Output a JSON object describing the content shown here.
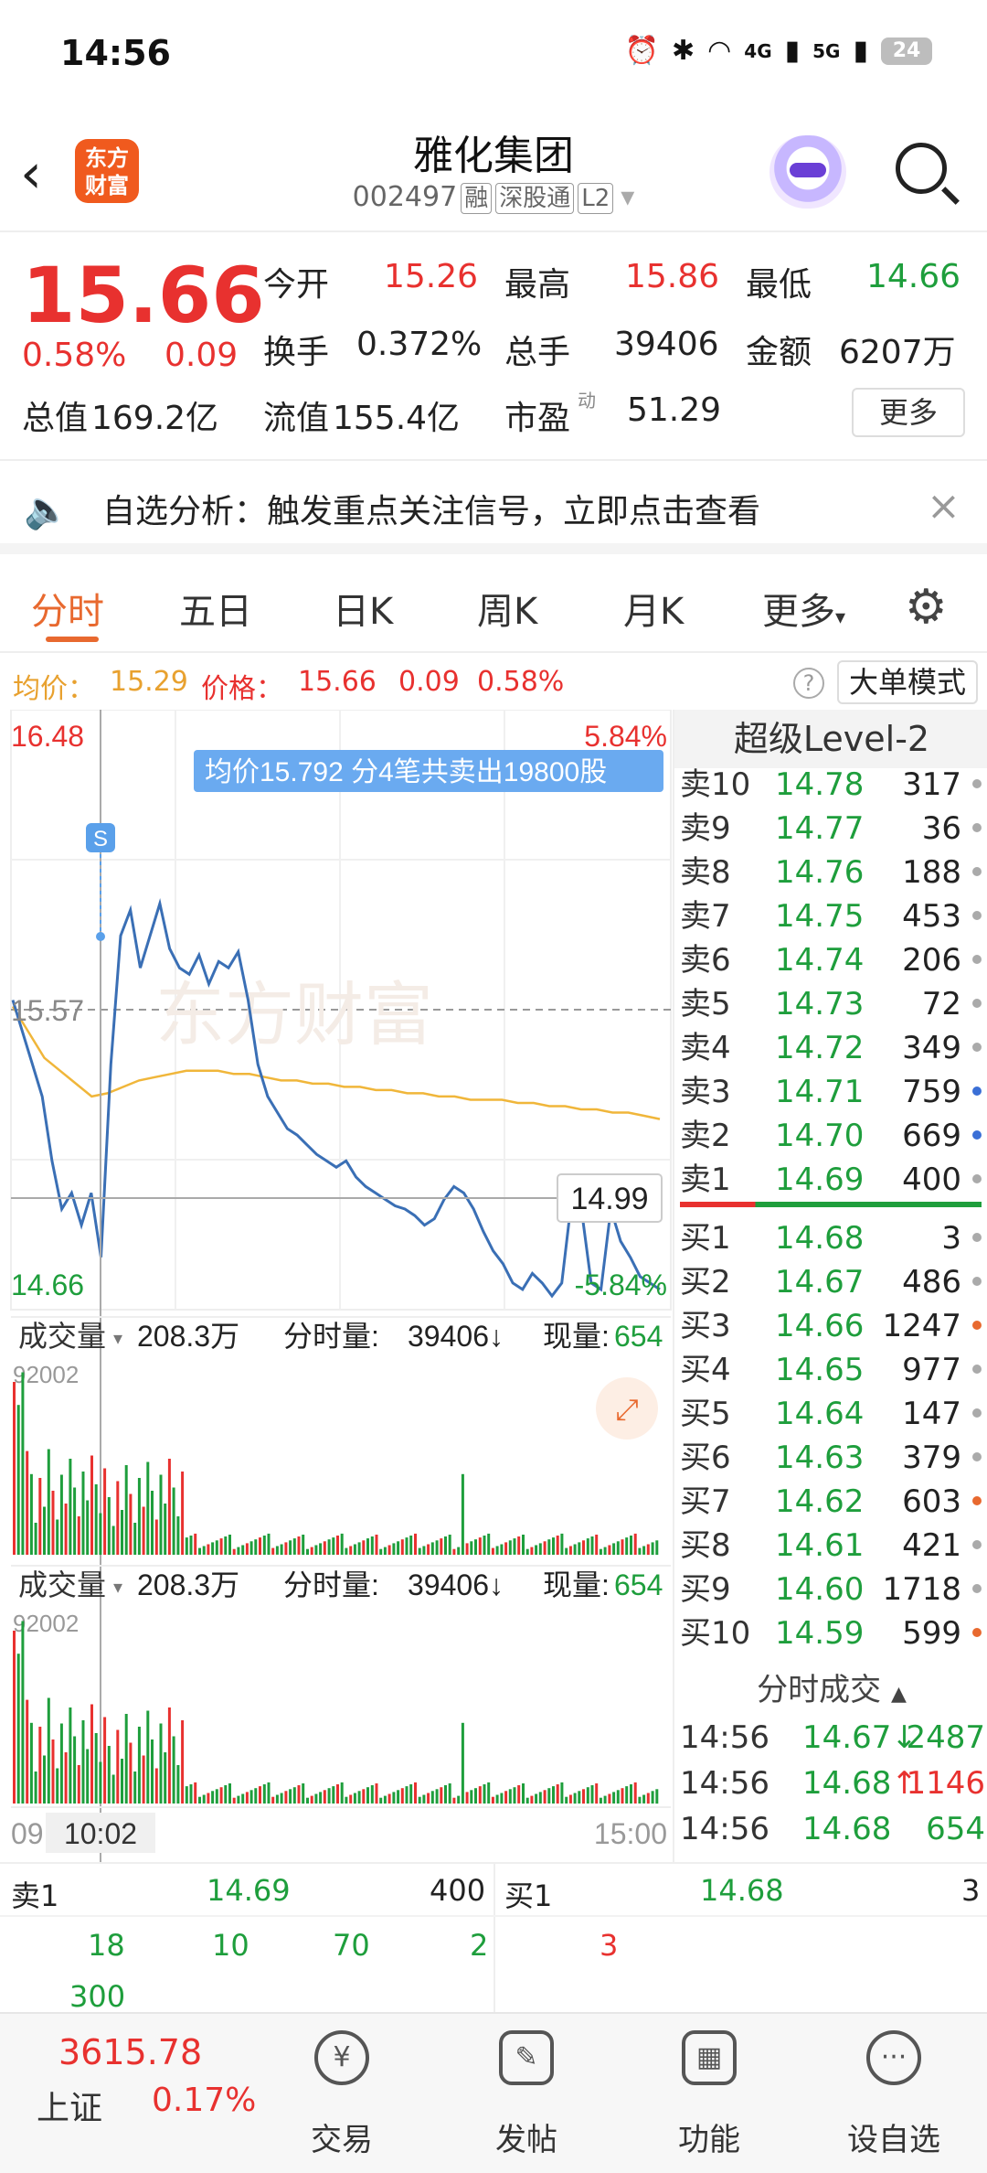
{
  "status": {
    "time": "14:56",
    "net1": "4G",
    "net2": "5G",
    "battery": "24"
  },
  "header": {
    "title": "雅化集团",
    "code": "002497",
    "tags": [
      "融",
      "深股通",
      "L2"
    ],
    "logo": "东方\n财富"
  },
  "quote": {
    "price": "15.66",
    "pct": "0.58%",
    "chg": "0.09",
    "open_label": "今开",
    "open": "15.26",
    "high_label": "最高",
    "high": "15.86",
    "low_label": "最低",
    "low": "14.66",
    "turnover_label": "换手",
    "turnover": "0.372%",
    "vol_label": "总手",
    "vol": "39406",
    "amount_label": "金额",
    "amount": "6207万",
    "mktcap_label": "总值",
    "mktcap": "169.2亿",
    "float_label": "流值",
    "float": "155.4亿",
    "pe_label": "市盈",
    "pe_sup": "动",
    "pe": "51.29",
    "more": "更多"
  },
  "notice": {
    "text": "自选分析：触发重点关注信号，立即点击查看"
  },
  "tabs": [
    "分时",
    "五日",
    "日K",
    "周K",
    "月K",
    "更多"
  ],
  "avgbar": {
    "avg_label": "均价：",
    "avg": "15.29",
    "price_label": "价格：",
    "price": "15.66",
    "chg": "0.09",
    "pct": "0.58%",
    "mode": "大单模式"
  },
  "chart": {
    "y_top": "16.48",
    "y_mid": "15.57",
    "y_bottom": "14.66",
    "pct_top": "5.84%",
    "pct_bottom": "-5.84%",
    "tooltip": "均价15.792  分4笔共卖出19800股",
    "signal": "S",
    "cursor_price": "14.99",
    "watermark": "东方财富",
    "vol_panel": {
      "label": "成交量",
      "total": "208.3万",
      "seg_label": "分时量:",
      "seg": "39406↓",
      "now_label": "现量:",
      "now": "654",
      "ymax": "92002"
    },
    "x_start": "09",
    "x_cursor": "10:02",
    "x_end": "15:00"
  },
  "chart_data": {
    "type": "line",
    "title": "",
    "xlabel": "",
    "ylabel": "",
    "ylim": [
      14.66,
      16.48
    ],
    "series": [
      {
        "values": [
          15.6,
          15.5,
          15.4,
          15.3,
          15.1,
          14.95,
          15.0,
          14.9,
          15.0,
          14.8,
          15.4,
          15.8,
          15.88,
          15.7,
          15.8,
          15.9,
          15.76,
          15.7,
          15.68,
          15.74,
          15.65,
          15.72,
          15.7,
          15.75,
          15.6,
          15.4,
          15.3,
          15.25,
          15.2,
          15.18,
          15.15,
          15.12,
          15.1,
          15.08,
          15.1,
          15.05,
          15.02,
          15.0,
          14.98,
          14.96,
          14.95,
          14.93,
          14.9,
          14.92,
          14.98,
          15.02,
          15.0,
          14.95,
          14.88,
          14.82,
          14.78,
          14.72,
          14.7,
          14.75,
          14.72,
          14.68,
          14.72,
          14.98,
          14.95,
          14.72,
          14.7,
          14.95,
          14.85,
          14.8,
          14.74,
          14.72,
          14.7
        ]
      },
      {
        "values": [
          15.58,
          15.5,
          15.42,
          15.38,
          15.34,
          15.3,
          15.31,
          15.33,
          15.35,
          15.36,
          15.37,
          15.38,
          15.38,
          15.38,
          15.37,
          15.37,
          15.36,
          15.35,
          15.35,
          15.34,
          15.34,
          15.33,
          15.33,
          15.32,
          15.32,
          15.31,
          15.31,
          15.3,
          15.3,
          15.29,
          15.29,
          15.29,
          15.28,
          15.28,
          15.27,
          15.27,
          15.26,
          15.26,
          15.25,
          15.25,
          15.24,
          15.23
        ]
      }
    ]
  },
  "book": {
    "head": "超级Level-2",
    "asks": [
      {
        "label": "卖10",
        "price": "14.78",
        "vol": "317"
      },
      {
        "label": "卖9",
        "price": "14.77",
        "vol": "36"
      },
      {
        "label": "卖8",
        "price": "14.76",
        "vol": "188"
      },
      {
        "label": "卖7",
        "price": "14.75",
        "vol": "453"
      },
      {
        "label": "卖6",
        "price": "14.74",
        "vol": "206"
      },
      {
        "label": "卖5",
        "price": "14.73",
        "vol": "72"
      },
      {
        "label": "卖4",
        "price": "14.72",
        "vol": "349"
      },
      {
        "label": "卖3",
        "price": "14.71",
        "vol": "759"
      },
      {
        "label": "卖2",
        "price": "14.70",
        "vol": "669"
      },
      {
        "label": "卖1",
        "price": "14.69",
        "vol": "400"
      }
    ],
    "bids": [
      {
        "label": "买1",
        "price": "14.68",
        "vol": "3"
      },
      {
        "label": "买2",
        "price": "14.67",
        "vol": "486"
      },
      {
        "label": "买3",
        "price": "14.66",
        "vol": "1247"
      },
      {
        "label": "买4",
        "price": "14.65",
        "vol": "977"
      },
      {
        "label": "买5",
        "price": "14.64",
        "vol": "147"
      },
      {
        "label": "买6",
        "price": "14.63",
        "vol": "379"
      },
      {
        "label": "买7",
        "price": "14.62",
        "vol": "603"
      },
      {
        "label": "买8",
        "price": "14.61",
        "vol": "421"
      },
      {
        "label": "买9",
        "price": "14.60",
        "vol": "1718"
      },
      {
        "label": "买10",
        "price": "14.59",
        "vol": "599"
      }
    ],
    "trades_head": "分时成交",
    "trades": [
      {
        "t": "14:56",
        "p": "14.67",
        "dir": "↓",
        "v": "2487"
      },
      {
        "t": "14:56",
        "p": "14.68",
        "dir": "↑",
        "v": "1146"
      },
      {
        "t": "14:56",
        "p": "14.68",
        "dir": "",
        "v": "654"
      }
    ]
  },
  "level": {
    "sell_label": "卖1",
    "sell_price": "14.69",
    "sell_vol": "400",
    "buy_label": "买1",
    "buy_price": "14.68",
    "buy_vol": "3",
    "sell_queue": [
      "18",
      "10",
      "70",
      "2",
      "300"
    ],
    "buy_queue": [
      "3"
    ]
  },
  "nav": {
    "index_value": "3615.78",
    "index_name": "上证",
    "index_pct": "0.17%",
    "items": [
      "交易",
      "发帖",
      "功能",
      "设自选"
    ]
  }
}
